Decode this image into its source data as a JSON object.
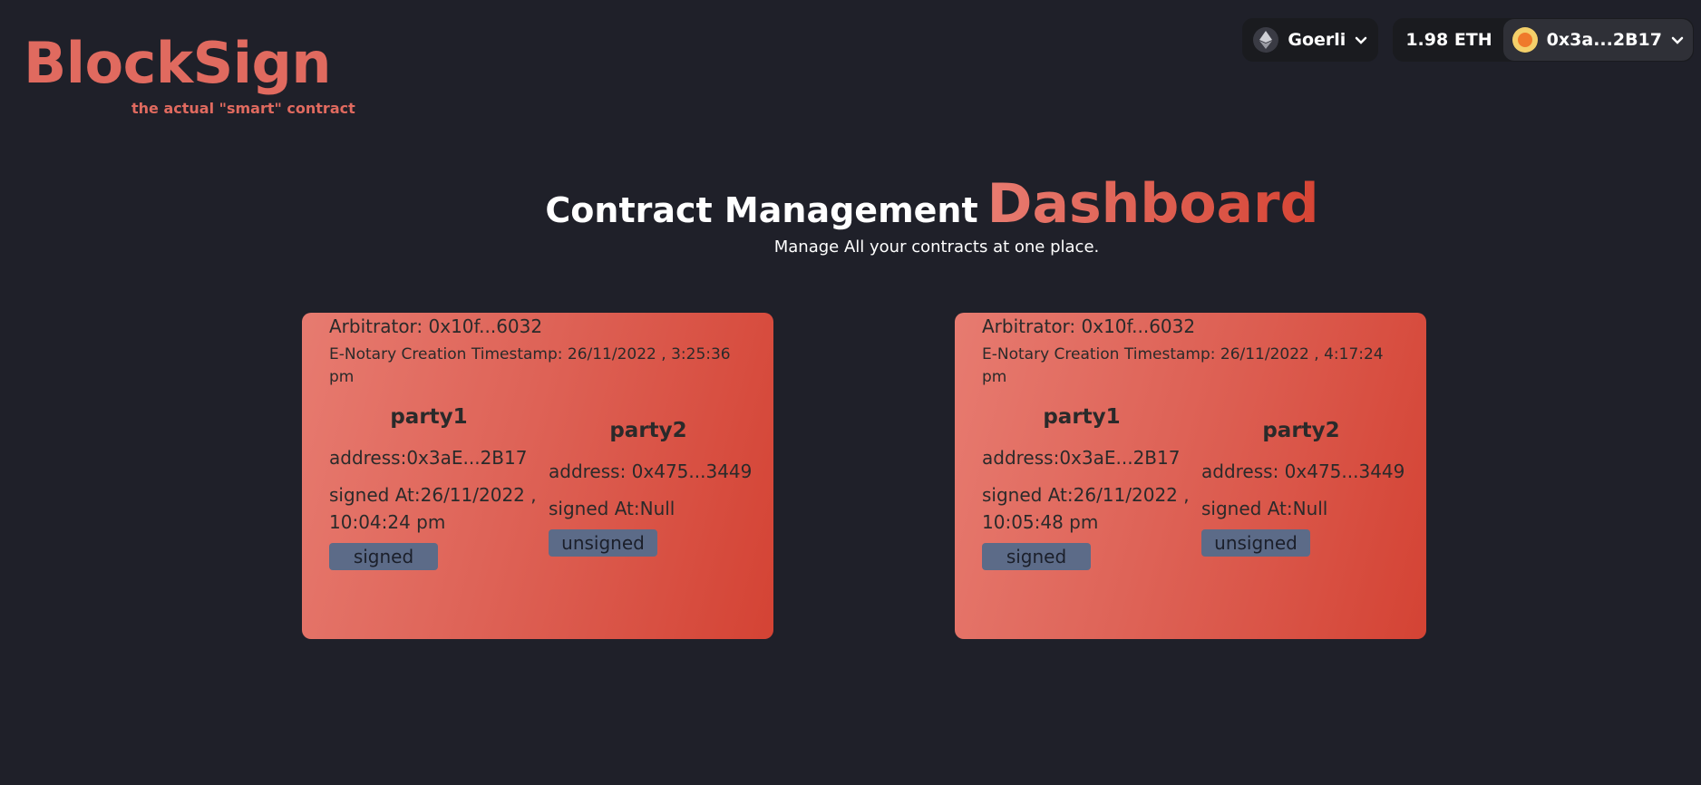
{
  "brand": {
    "title": "BlockSign",
    "tagline": "the actual \"smart\" contract"
  },
  "wallet": {
    "network": "Goerli",
    "network_icon": "ethereum-icon",
    "balance": "1.98 ETH",
    "account": "0x3a...2B17",
    "chevron": "❯"
  },
  "header": {
    "title": "Contract Management",
    "accent": "Dashboard",
    "subtitle": "Manage All your contracts at one place."
  },
  "contracts": [
    {
      "arbitrator": "Arbitrator: 0x10f...6032",
      "timestamp": "E-Notary Creation Timestamp: 26/11/2022 , 3:25:36 pm",
      "party1": {
        "title": "party1",
        "address": "address:0x3aE...2B17",
        "signed_at": "signed At:26/11/2022 , 10:04:24 pm",
        "status": "signed"
      },
      "party2": {
        "title": "party2",
        "address": "address: 0x475...3449",
        "signed_at": "signed At:Null",
        "status": "unsigned"
      }
    },
    {
      "arbitrator": "Arbitrator: 0x10f...6032",
      "timestamp": "E-Notary Creation Timestamp: 26/11/2022 , 4:17:24 pm",
      "party1": {
        "title": "party1",
        "address": "address:0x3aE...2B17",
        "signed_at": "signed At:26/11/2022 , 10:05:48 pm",
        "status": "signed"
      },
      "party2": {
        "title": "party2",
        "address": "address: 0x475...3449",
        "signed_at": "signed At:Null",
        "status": "unsigned"
      }
    }
  ],
  "colors": {
    "background": "#1f2029",
    "brand": "#e06a5f",
    "card_gradient_start": "#e77b70",
    "card_gradient_end": "#d44334",
    "badge": "#5c6b88"
  }
}
